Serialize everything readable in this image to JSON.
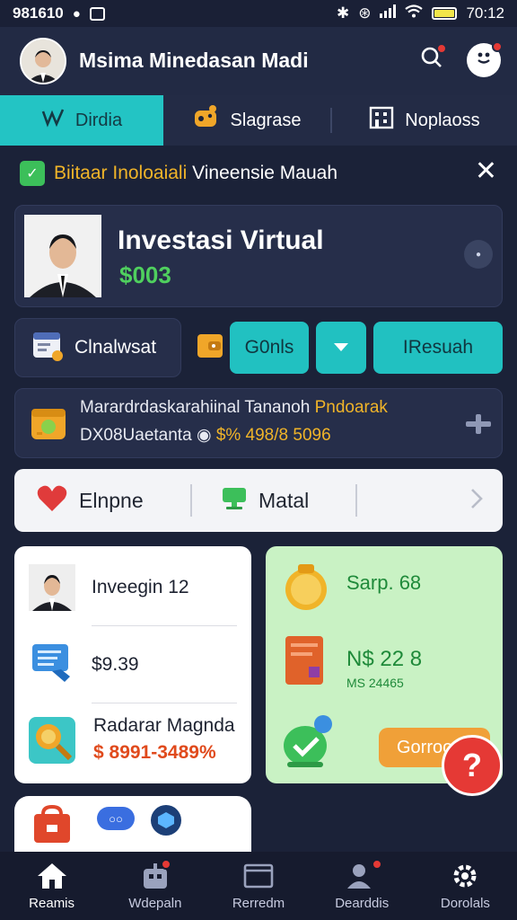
{
  "status_bar": {
    "time_left": "981610",
    "time_right": "70:12"
  },
  "header": {
    "title": "Msima Minedasan Madi"
  },
  "tabs": [
    {
      "label": "Dirdia",
      "icon": "chart-icon"
    },
    {
      "label": "Slagrase",
      "icon": "game-icon"
    },
    {
      "label": "Noplaoss",
      "icon": "building-icon"
    }
  ],
  "banner": {
    "highlight": "Biitaar Inoloaiali",
    "text": "Vineensie Mauah"
  },
  "profile": {
    "name": "Investasi Virtual",
    "amount": "$003"
  },
  "actions": {
    "card_label": "Clnalwsat",
    "pill1": "G0nls",
    "pill3": "IResuah"
  },
  "info": {
    "line1_text": "Marardrdaskarahiinal Tananoh",
    "line1_highlight": "Pndoarak",
    "line2_text": "DX08Uaetanta",
    "line2_highlight": "$% 498/8 5096"
  },
  "white_bar": {
    "item1": "Elnpne",
    "item2": "Matal"
  },
  "left_panel": {
    "row1": "Inveegin 12",
    "row2": "$9.39",
    "row3_title": "Radarar Magnda",
    "row3_value": "$ 8991-3489%"
  },
  "right_panel": {
    "row1": "Sarp. 68",
    "row2_main": "N$ 22 8",
    "row2_sub": "MS 24465",
    "button": "Gorroo"
  },
  "fab": {
    "label": "?"
  },
  "bottom_nav": [
    {
      "label": "Reamis",
      "icon": "home-icon",
      "badge": false
    },
    {
      "label": "Wdepaln",
      "icon": "robot-icon",
      "badge": true
    },
    {
      "label": "Rerredm",
      "icon": "inbox-icon",
      "badge": false
    },
    {
      "label": "Dearddis",
      "icon": "user-icon",
      "badge": true
    },
    {
      "label": "Dorolals",
      "icon": "gear-icon",
      "badge": false
    }
  ]
}
